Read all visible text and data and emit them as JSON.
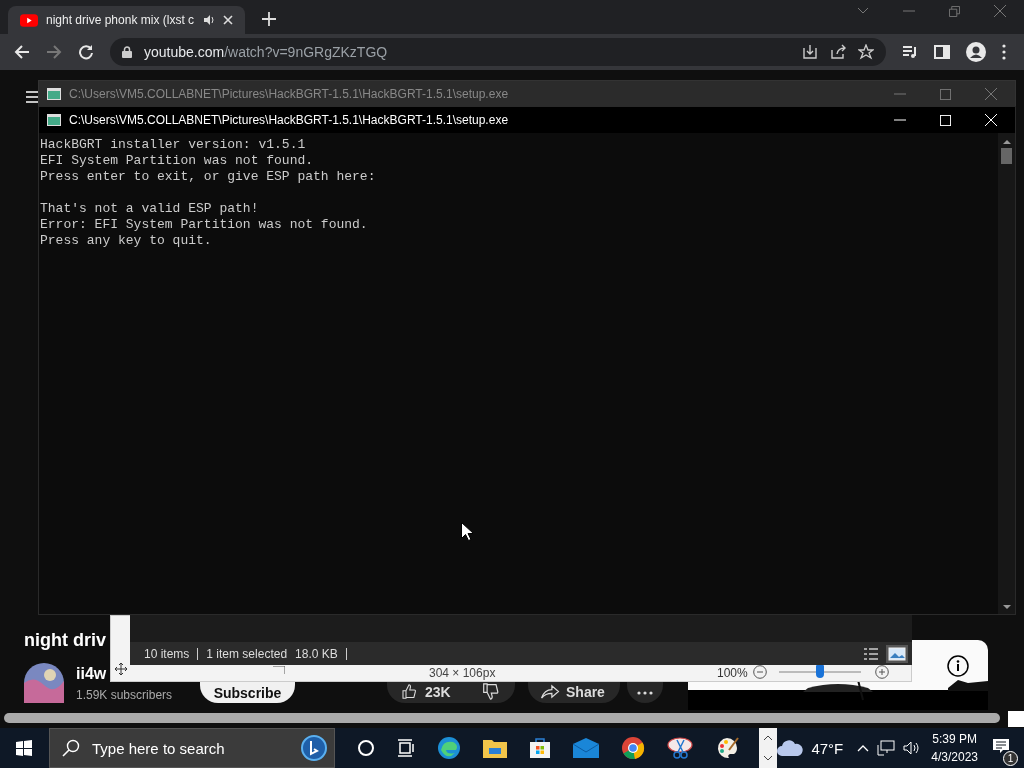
{
  "browser": {
    "tab": {
      "title": "night drive phonk mix (lxst c",
      "audio_playing": true
    },
    "url_host": "youtube.com",
    "url_path": "/watch?v=9nGRgZKzTGQ"
  },
  "video_page": {
    "title": "night driv",
    "channel": "ii4w",
    "subscribers": "1.59K subscribers",
    "subscribe": "Subscribe",
    "likes": "23K",
    "share": "Share"
  },
  "background_window": {
    "title": "C:\\Users\\VM5.COLLABNET\\Pictures\\HackBGRT-1.5.1\\HackBGRT-1.5.1\\setup.exe"
  },
  "console": {
    "title": "C:\\Users\\VM5.COLLABNET\\Pictures\\HackBGRT-1.5.1\\HackBGRT-1.5.1\\setup.exe",
    "output_blocks": [
      [
        "HackBGRT installer version: v1.5.1",
        "EFI System Partition was not found.",
        "Press enter to exit, or give ESP path here:"
      ],
      [
        "That's not a valid ESP path!",
        "Error: EFI System Partition was not found.",
        "Press any key to quit."
      ]
    ]
  },
  "explorer_status": {
    "items": "10 items",
    "selected": "1 item selected",
    "size": "18.0 KB"
  },
  "image_viewer_status": {
    "dimensions": "304 × 106px",
    "zoom": "100%",
    "level": 0.5
  },
  "taskbar": {
    "search_placeholder": "Type here to search",
    "weather": "47°F",
    "time": "5:39 PM",
    "date": "4/3/2023",
    "notifications": "1"
  }
}
